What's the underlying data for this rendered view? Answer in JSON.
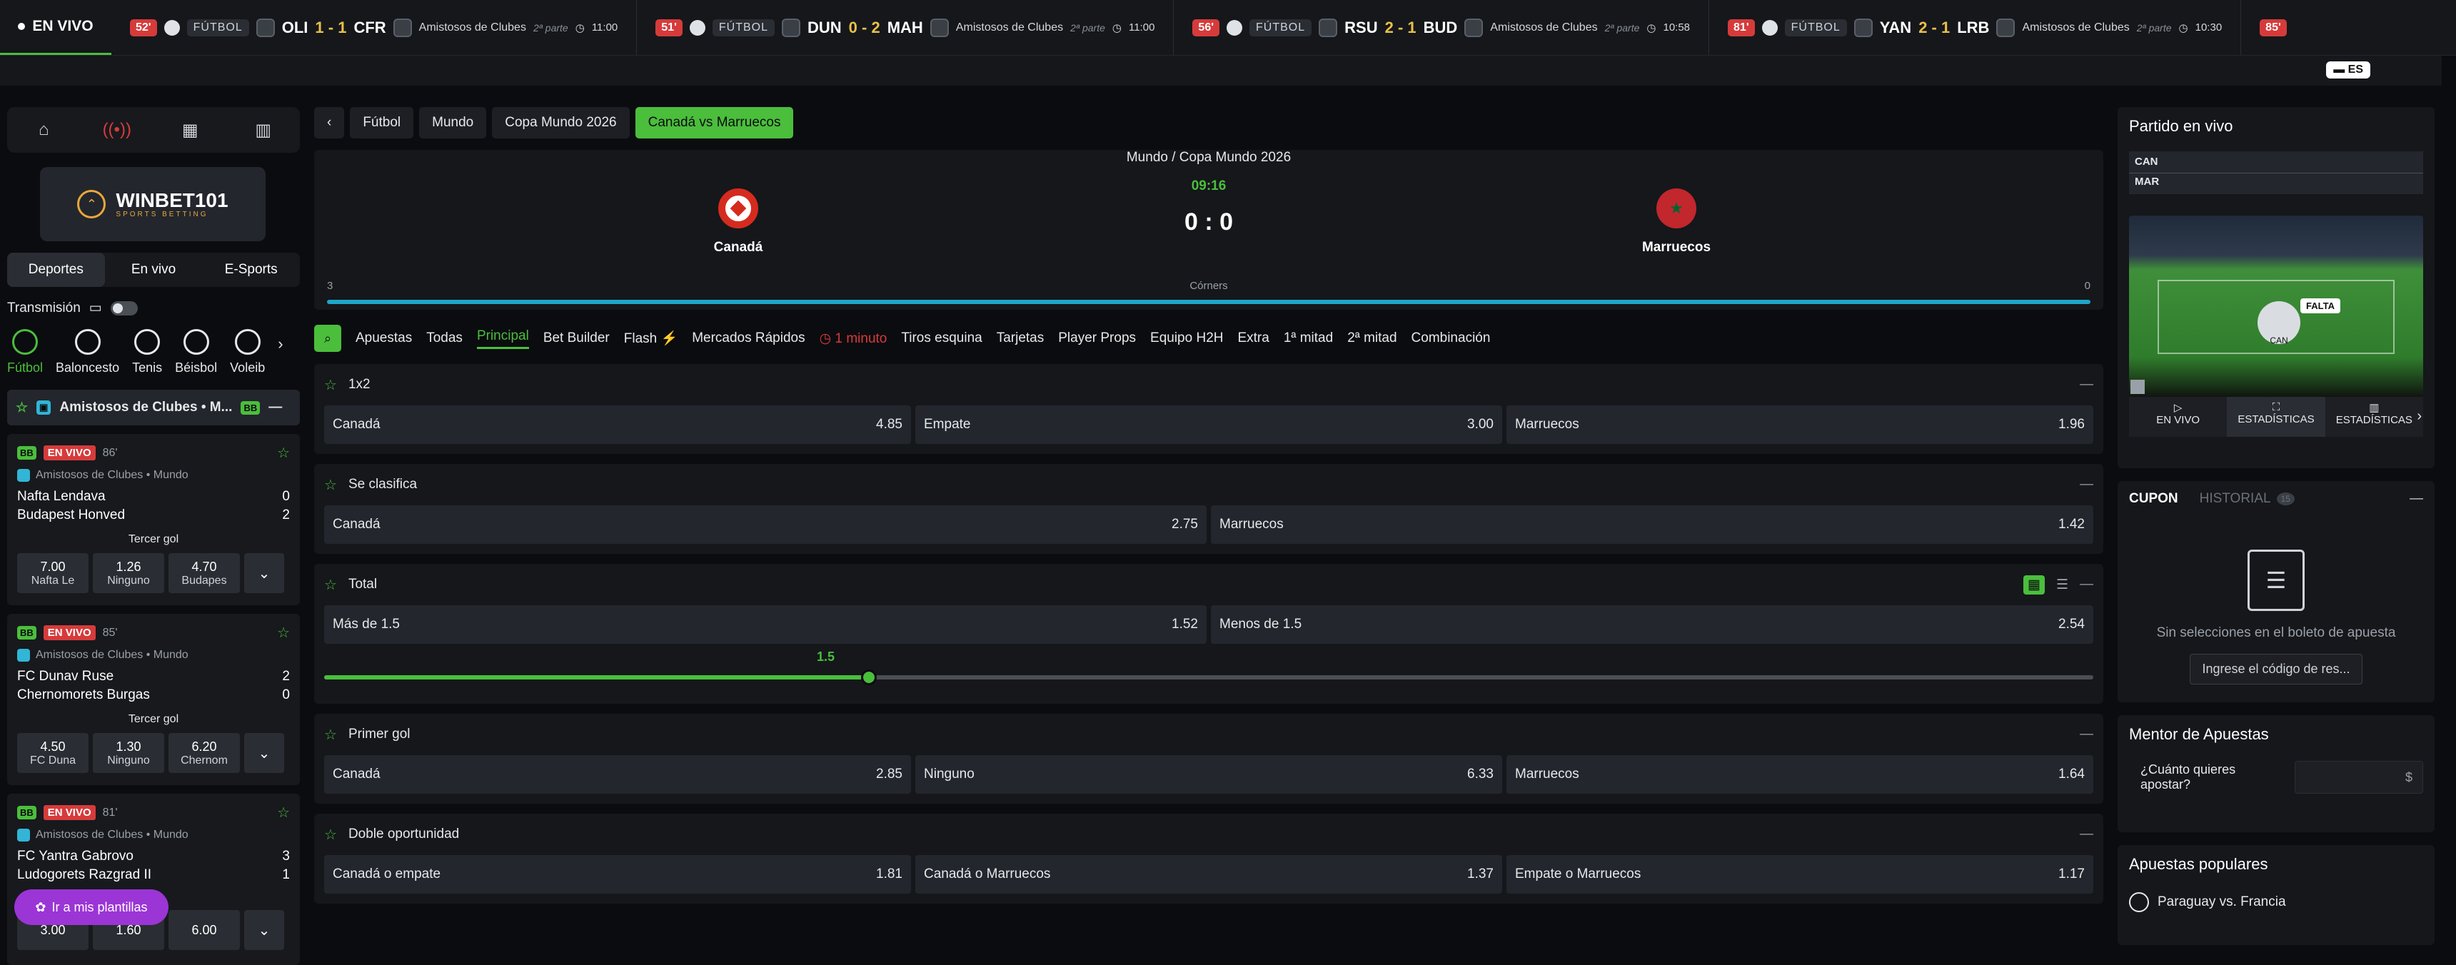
{
  "ticker": {
    "live_label": "EN VIVO",
    "items": [
      {
        "minute": "52'",
        "sport": "FÚTBOL",
        "home": "OLI",
        "score": "1 - 1",
        "away": "CFR",
        "competition": "Amistosos de Clubes",
        "half": "2ª parte",
        "time": "11:00"
      },
      {
        "minute": "51'",
        "sport": "FÚTBOL",
        "home": "DUN",
        "score": "0 - 2",
        "away": "MAH",
        "competition": "Amistosos de Clubes",
        "half": "2ª parte",
        "time": "11:00"
      },
      {
        "minute": "56'",
        "sport": "FÚTBOL",
        "home": "RSU",
        "score": "2 - 1",
        "away": "BUD",
        "competition": "Amistosos de Clubes",
        "half": "2ª parte",
        "time": "10:58"
      },
      {
        "minute": "81'",
        "sport": "FÚTBOL",
        "home": "YAN",
        "score": "2 - 1",
        "away": "LRB",
        "competition": "Amistosos de Clubes",
        "half": "2ª parte",
        "time": "10:30"
      },
      {
        "minute": "85'"
      }
    ]
  },
  "lang": "ES",
  "sidebar": {
    "logo_name": "WINBET101",
    "logo_sub": "SPORTS BETTING",
    "tabs": [
      "Deportes",
      "En vivo",
      "E-Sports"
    ],
    "transmission_label": "Transmisión",
    "sports": [
      "Fútbol",
      "Baloncesto",
      "Tenis",
      "Béisbol",
      "Voleib"
    ],
    "league_header": "Amistosos de Clubes • M...",
    "bb_label": "BB",
    "live_label": "EN VIVO",
    "matches": [
      {
        "minute": "86'",
        "league": "Amistosos de Clubes • Mundo",
        "home": "Nafta Lendava",
        "away": "Budapest Honved",
        "home_score": "0",
        "away_score": "2",
        "market": "Tercer gol",
        "odds": [
          {
            "v": "7.00",
            "l": "Nafta Le"
          },
          {
            "v": "1.26",
            "l": "Ninguno"
          },
          {
            "v": "4.70",
            "l": "Budapes"
          }
        ]
      },
      {
        "minute": "85'",
        "league": "Amistosos de Clubes • Mundo",
        "home": "FC Dunav Ruse",
        "away": "Chernomorets Burgas",
        "home_score": "2",
        "away_score": "0",
        "market": "Tercer gol",
        "odds": [
          {
            "v": "4.50",
            "l": "FC Duna"
          },
          {
            "v": "1.30",
            "l": "Ninguno"
          },
          {
            "v": "6.20",
            "l": "Chernom"
          }
        ]
      },
      {
        "minute": "81'",
        "league": "Amistosos de Clubes • Mundo",
        "home": "FC Yantra Gabrovo",
        "away": "Ludogorets Razgrad II",
        "home_score": "3",
        "away_score": "1",
        "market": "",
        "odds": [
          {
            "v": "3.00",
            "l": ""
          },
          {
            "v": "1.60",
            "l": ""
          },
          {
            "v": "6.00",
            "l": ""
          }
        ]
      }
    ],
    "templates_button": "Ir a mis plantillas"
  },
  "main": {
    "crumbs": [
      "Fútbol",
      "Mundo",
      "Copa Mundo 2026",
      "Canadá  vs  Marruecos"
    ],
    "header": {
      "competition": "Mundo / Copa Mundo 2026",
      "clock": "09:16",
      "score": "0 : 0",
      "home": "Canadá",
      "away": "Marruecos",
      "stat_left": "3",
      "stat_label": "Córners",
      "stat_right": "0"
    },
    "tabs": [
      "Apuestas",
      "Todas",
      "Principal",
      "Bet Builder",
      "Flash",
      "Mercados Rápidos",
      "1 minuto",
      "Tiros esquina",
      "Tarjetas",
      "Player Props",
      "Equipo H2H",
      "Extra",
      "1ª mitad",
      "2ª mitad",
      "Combinación"
    ],
    "markets": [
      {
        "title": "1x2",
        "selections": [
          {
            "n": "Canadá",
            "o": "4.85"
          },
          {
            "n": "Empate",
            "o": "3.00"
          },
          {
            "n": "Marruecos",
            "o": "1.96"
          }
        ]
      },
      {
        "title": "Se clasifica",
        "selections": [
          {
            "n": "Canadá",
            "o": "2.75"
          },
          {
            "n": "Marruecos",
            "o": "1.42"
          }
        ]
      },
      {
        "title": "Total",
        "selections": [
          {
            "n": "Más de 1.5",
            "o": "1.52"
          },
          {
            "n": "Menos de 1.5",
            "o": "2.54"
          }
        ],
        "slider_value": "1.5"
      },
      {
        "title": "Primer gol",
        "selections": [
          {
            "n": "Canadá",
            "o": "2.85"
          },
          {
            "n": "Ninguno",
            "o": "6.33"
          },
          {
            "n": "Marruecos",
            "o": "1.64"
          }
        ]
      },
      {
        "title": "Doble oportunidad",
        "selections": [
          {
            "n": "Canadá o empate",
            "o": "1.81"
          },
          {
            "n": "Canadá o Marruecos",
            "o": "1.37"
          },
          {
            "n": "Empate o Marruecos",
            "o": "1.17"
          }
        ]
      }
    ]
  },
  "right": {
    "live_title": "Partido en vivo",
    "tracker": {
      "home": "CAN",
      "away": "MAR",
      "event": "FALTA",
      "event_team": "CAN"
    },
    "live_tabs": [
      "EN VIVO",
      "ESTADÍSTICAS",
      "ESTADÍSTICAS"
    ],
    "cupon_title": "CUPON",
    "historial_title": "HISTORIAL",
    "historial_count": "15",
    "empty_text": "Sin selecciones en el boleto de apuesta",
    "code_button": "Ingrese el código de res...",
    "mentor_title": "Mentor de Apuestas",
    "mentor_question": "¿Cuánto quieres apostar?",
    "currency": "$",
    "popular_title": "Apuestas populares",
    "popular_item": "Paraguay vs. Francia"
  }
}
